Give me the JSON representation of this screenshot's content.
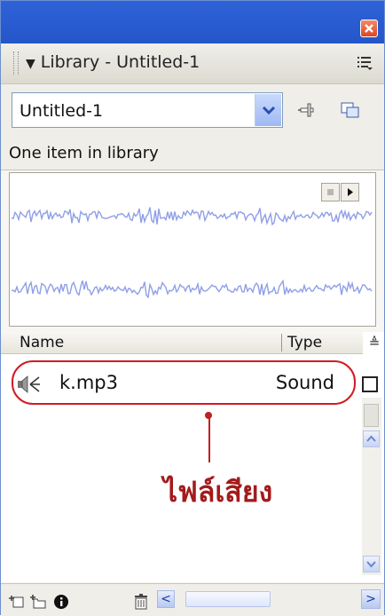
{
  "panel": {
    "title": "Library - Untitled-1",
    "collapse_glyph": "▼"
  },
  "document_select": {
    "value": "Untitled-1"
  },
  "info_bar": {
    "text": "One item in library"
  },
  "preview": {
    "stop_icon": "stop-icon",
    "play_icon": "play-icon"
  },
  "list": {
    "columns": [
      "Name",
      "Type"
    ],
    "sort_glyph": "≜",
    "items": [
      {
        "name": "k.mp3",
        "type": "Sound",
        "icon": "sound-icon"
      }
    ]
  },
  "annotation": {
    "text": "ไฟล์เสียง",
    "color": "#a31b1b"
  },
  "toolbar": {
    "icons": [
      "new-symbol-icon",
      "new-folder-icon",
      "properties-icon",
      "delete-icon"
    ],
    "scroll_left": "<",
    "scroll_right": ">"
  },
  "colors": {
    "accent": "#2456c9",
    "waveform": "#8f9fe6",
    "highlight": "#d11b22"
  }
}
